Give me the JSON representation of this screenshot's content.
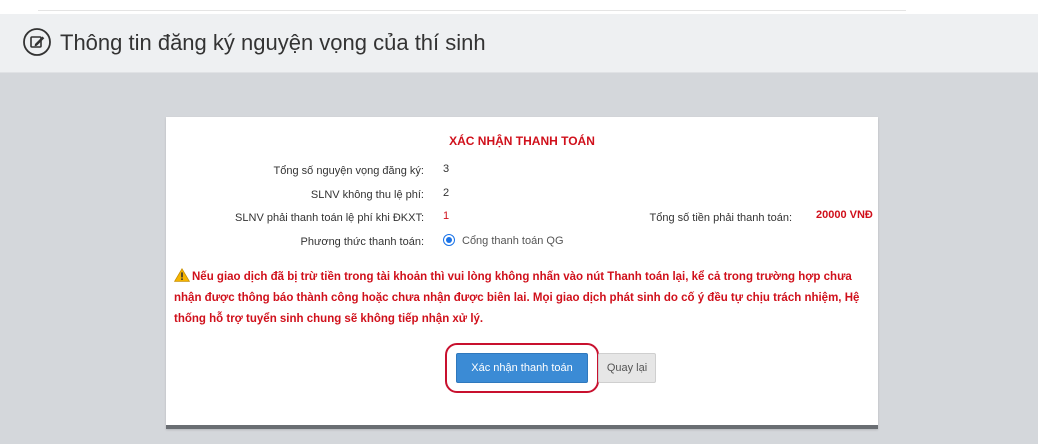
{
  "header": {
    "title": "Thông tin đăng ký nguyện vọng của thí sinh",
    "icon": "edit-icon"
  },
  "card": {
    "title": "XÁC NHẬN THANH TOÁN",
    "fields": {
      "total_wishes_label": "Tổng số nguyện vọng đăng ký:",
      "total_wishes_value": "3",
      "free_wishes_label": "SLNV không thu lệ phí:",
      "free_wishes_value": "2",
      "paid_wishes_label": "SLNV phải thanh toán lệ phí khi ĐKXT:",
      "paid_wishes_value": "1",
      "total_amount_label": "Tổng số tiền phải thanh toán:",
      "total_amount_value": "20000 VNĐ",
      "payment_method_label": "Phương thức thanh toán:",
      "payment_method_option": "Cổng thanh toán QG",
      "payment_method_selected": true
    },
    "warning": "Nếu giao dịch đã bị trừ tiền trong tài khoản thì vui lòng không nhấn vào nút Thanh toán lại, kể cả trong trường hợp chưa nhận được thông báo thành công hoặc chưa nhận được biên lai. Mọi giao dịch phát sinh do cố ý đều tự chịu trách nhiệm, Hệ thống hỗ trợ tuyển sinh chung sẽ không tiếp nhận xử lý.",
    "buttons": {
      "confirm": "Xác nhận thanh toán",
      "back": "Quay lại"
    }
  },
  "colors": {
    "accent_red": "#d0101b",
    "primary_blue": "#3b8bd5",
    "highlight_red": "#c8102e",
    "page_gray": "#d4d7db"
  }
}
